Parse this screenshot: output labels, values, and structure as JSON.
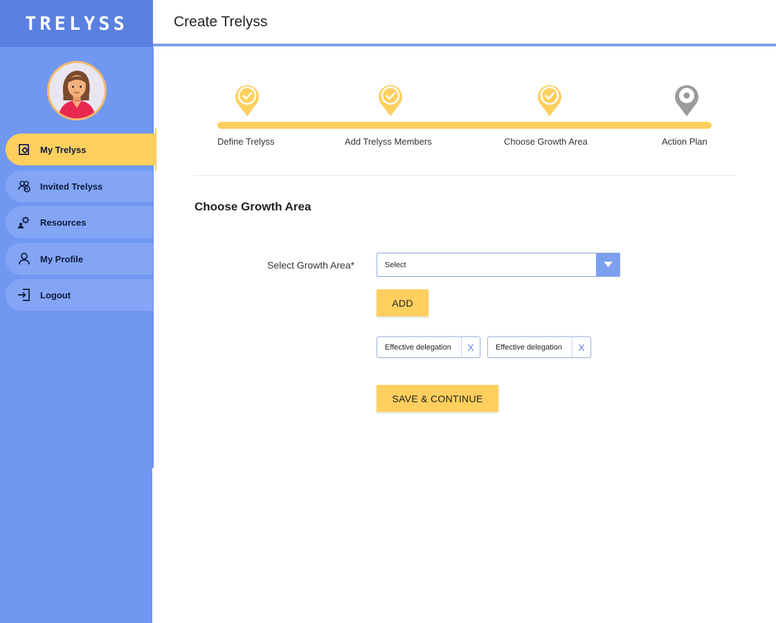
{
  "brand": {
    "name": "TRELYSS"
  },
  "header": {
    "title": "Create Trelyss"
  },
  "sidebar": {
    "items": [
      {
        "label": "My Trelyss",
        "icon": "settings-document-icon",
        "active": true
      },
      {
        "label": "Invited Trelyss",
        "icon": "group-icon",
        "active": false
      },
      {
        "label": "Resources",
        "icon": "resources-gear-icon",
        "active": false
      },
      {
        "label": "My Profile",
        "icon": "user-icon",
        "active": false
      },
      {
        "label": "Logout",
        "icon": "logout-icon",
        "active": false
      }
    ]
  },
  "stepper": {
    "steps": [
      {
        "label": "Define Trelyss",
        "status": "complete"
      },
      {
        "label": "Add Trelyss Members",
        "status": "complete"
      },
      {
        "label": "Choose Growth Area",
        "status": "complete"
      },
      {
        "label": "Action Plan",
        "status": "pending"
      }
    ]
  },
  "form": {
    "section_title": "Choose Growth Area",
    "field_label": "Select Growth Area*",
    "select_value": "Select",
    "add_label": "ADD",
    "chips": [
      {
        "label": "Effective delegation",
        "close": "X"
      },
      {
        "label": "Effective delegation",
        "close": "X"
      }
    ],
    "save_label": "SAVE & CONTINUE"
  },
  "colors": {
    "sidebar": "#7198f1",
    "brand_bar": "#5a80e0",
    "accent": "#ffcf5e",
    "pending": "#9b9b9b",
    "header_line": "#7d9fe9"
  }
}
